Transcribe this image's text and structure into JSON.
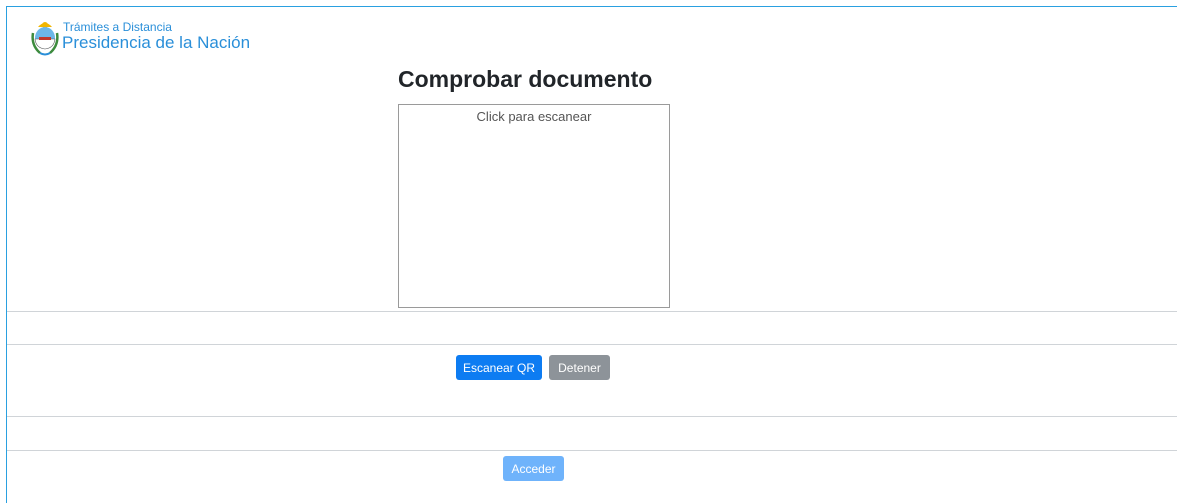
{
  "header": {
    "logo_line1": "Trámites a Distancia",
    "logo_line2": "Presidencia de la Nación",
    "emblem_icon": "argentina-coat-of-arms-icon"
  },
  "main": {
    "title": "Comprobar documento",
    "scanner_placeholder": "Click para escanear"
  },
  "actions": {
    "scan_label": "Escanear QR",
    "stop_label": "Detener",
    "access_label": "Acceder"
  },
  "colors": {
    "frame_border": "#2aa0e0",
    "brand_text": "#2a8fd9",
    "primary": "#0d7cf2",
    "secondary": "#8d9399",
    "primary_disabled": "#6fb3fb"
  }
}
